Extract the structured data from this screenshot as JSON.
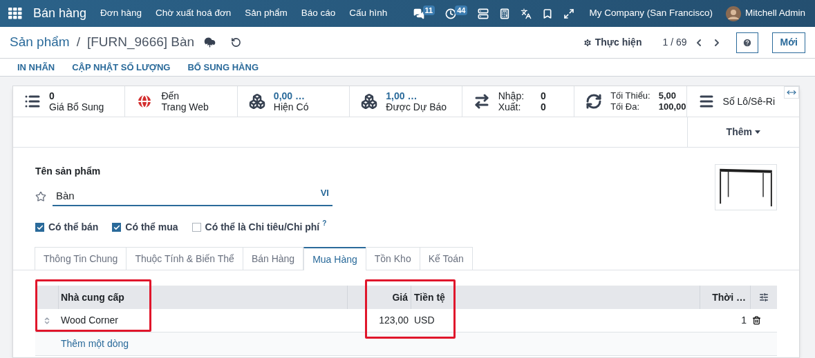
{
  "navbar": {
    "app_name": "Bán hàng",
    "menu": [
      "Đơn hàng",
      "Chờ xuất hoá đơn",
      "Sản phẩm",
      "Báo cáo",
      "Cấu hình"
    ],
    "messages_badge": "11",
    "activities_badge": "44",
    "company": "My Company (San Francisco)",
    "user": "Mitchell Admin"
  },
  "control_panel": {
    "breadcrumb_parent": "Sản phẩm",
    "separator": "/",
    "record": "[FURN_9666] Bàn",
    "action_menu": "Thực hiện",
    "pager": "1 / 69",
    "new_button": "Mới"
  },
  "header_buttons": [
    "IN NHÃN",
    "CẬP NHẬT SỐ LƯỢNG",
    "BỔ SUNG HÀNG"
  ],
  "stat_buttons": [
    {
      "kind": "count",
      "value": "0",
      "label": "Giá Bổ Sung"
    },
    {
      "kind": "website",
      "value": "Đến",
      "label": "Trang Web",
      "published": false
    },
    {
      "kind": "quantity",
      "value": "0,00 …",
      "label": "Hiện Có"
    },
    {
      "kind": "quantity",
      "value": "1,00 …",
      "label": "Được Dự Báo"
    },
    {
      "kind": "pairs",
      "rows": [
        {
          "label": "Nhập:",
          "value": "0"
        },
        {
          "label": "Xuất:",
          "value": "0"
        }
      ]
    },
    {
      "kind": "pairs",
      "rows": [
        {
          "label": "Tối Thiểu:",
          "value": "5,00"
        },
        {
          "label": "Tối Đa:",
          "value": "100,00"
        }
      ]
    },
    {
      "kind": "single",
      "label": "Số Lô/Sê-Ri"
    }
  ],
  "more_button": "Thêm",
  "form": {
    "name_label": "Tên sản phẩm",
    "favorite": false,
    "name_value": "Bàn",
    "language": "VI",
    "checkboxes": [
      {
        "label": "Có thể bán",
        "checked": true
      },
      {
        "label": "Có thể mua",
        "checked": true
      },
      {
        "label": "Có thể là Chi tiêu/Chi phí",
        "checked": false,
        "help": "?"
      }
    ]
  },
  "tabs": [
    {
      "label": "Thông Tin Chung",
      "selected": false
    },
    {
      "label": "Thuộc Tính & Biến Thể",
      "selected": false
    },
    {
      "label": "Bán Hàng",
      "selected": false
    },
    {
      "label": "Mua Hàng",
      "selected": true
    },
    {
      "label": "Tồn Kho",
      "selected": false
    },
    {
      "label": "Kế Toán",
      "selected": false
    }
  ],
  "table": {
    "columns": [
      "Nhà cung cấp",
      "Giá",
      "Tiền tệ",
      "Thời …"
    ],
    "rows": [
      {
        "cells": [
          "Wood Corner",
          "123,00",
          "USD",
          "1"
        ]
      }
    ],
    "add_line": "Thêm một dòng"
  }
}
